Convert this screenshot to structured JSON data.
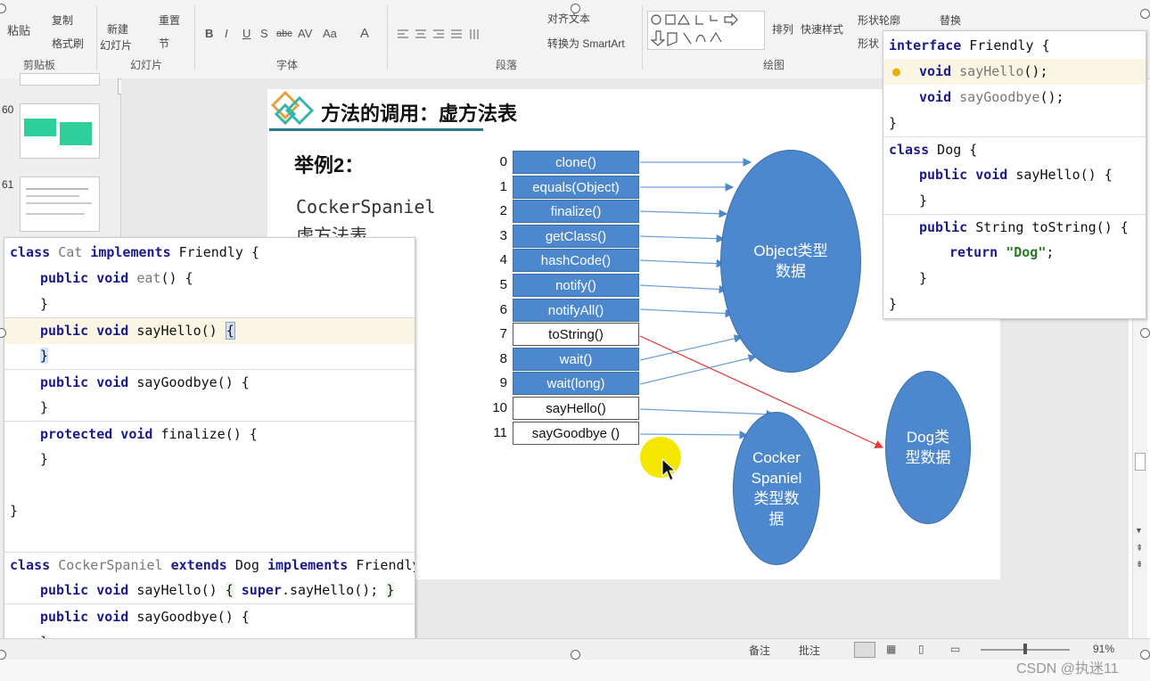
{
  "ribbon": {
    "clipboard": {
      "paste": "粘贴",
      "copy": "复制",
      "format_painter": "格式刷",
      "group": "剪贴板"
    },
    "slides": {
      "new_slide": "新建",
      "new_slide2": "幻灯片",
      "reset": "重置",
      "section": "节",
      "group": "幻灯片"
    },
    "font": {
      "group": "字体",
      "bold": "B",
      "italic": "I",
      "underline": "U",
      "shadow": "S",
      "strike": "abc",
      "spacing": "AV",
      "case": "Aa",
      "color": "A"
    },
    "paragraph": {
      "group": "段落",
      "align_text": "对齐文本",
      "smartart": "转换为 SmartArt"
    },
    "drawing": {
      "group": "绘图",
      "arrange": "排列",
      "quick_styles": "快速样式",
      "shape_outline": "形状轮廓",
      "shape_effects": "形状",
      "replace": "替换"
    }
  },
  "thumbs": [
    {
      "num": "60"
    },
    {
      "num": "61"
    }
  ],
  "slide": {
    "title": "方法的调用：虚方法表",
    "example": "举例2：",
    "subtitle1": "CockerSpaniel",
    "subtitle2": "虚方法表",
    "rows": [
      {
        "i": "0",
        "label": "clone()",
        "style": "blue"
      },
      {
        "i": "1",
        "label": "equals(Object)",
        "style": "blue"
      },
      {
        "i": "2",
        "label": "finalize()",
        "style": "blue"
      },
      {
        "i": "3",
        "label": "getClass()",
        "style": "blue"
      },
      {
        "i": "4",
        "label": "hashCode()",
        "style": "blue"
      },
      {
        "i": "5",
        "label": "notify()",
        "style": "blue"
      },
      {
        "i": "6",
        "label": "notifyAll()",
        "style": "blue"
      },
      {
        "i": "7",
        "label": "toString()",
        "style": "white"
      },
      {
        "i": "8",
        "label": "wait()",
        "style": "blue"
      },
      {
        "i": "9",
        "label": "wait(long)",
        "style": "blue"
      },
      {
        "i": "10",
        "label": "sayHello()",
        "style": "white"
      },
      {
        "i": "11",
        "label": "sayGoodbye ()",
        "style": "white"
      }
    ],
    "object_circle": "Object类型\n数据",
    "cocker_circle": "Cocker\nSpaniel\n类型数\n据",
    "dog_circle": "Dog类\n型数据"
  },
  "code_left": {
    "lines": [
      "class Cat implements Friendly {",
      "    public void eat() {",
      "    }",
      "    public void sayHello() {",
      "    }",
      "    public void sayGoodbye() {",
      "    }",
      "    protected void finalize() {",
      "    }",
      "",
      "}",
      "",
      "class CockerSpaniel extends Dog implements Friendly {",
      "    public void sayHello() { super.sayHello(); }",
      "    public void sayGoodbye() {",
      "    }"
    ]
  },
  "code_right": {
    "lines": [
      "interface Friendly {",
      "    void sayHello();",
      "    void sayGoodbye();",
      "}",
      "class Dog {",
      "    public void sayHello() {",
      "    }",
      "    public String toString() {",
      "        return \"Dog\";",
      "    }",
      "}"
    ]
  },
  "status": {
    "notes": "备注",
    "comments": "批注",
    "zoom": "91%"
  },
  "watermark": "CSDN @执迷11",
  "colors": {
    "table_blue": "#4d88cf",
    "arrow_red": "#e03a3a",
    "highlight": "#fbf6e3"
  }
}
